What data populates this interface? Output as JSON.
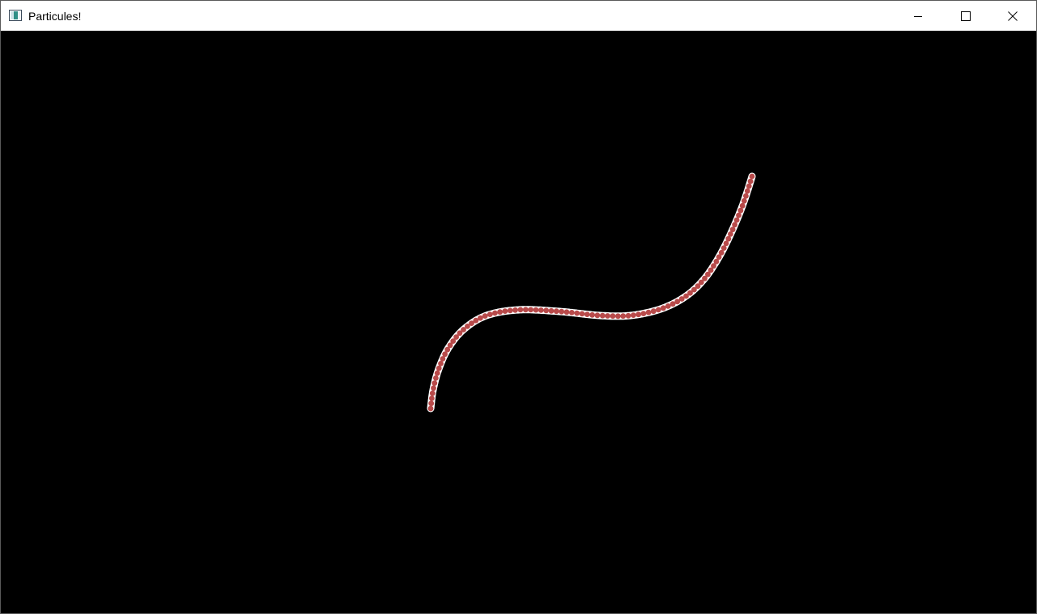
{
  "window": {
    "title": "Particules!",
    "icons": {
      "app": "app-window-icon",
      "minimize": "minimize-icon",
      "maximize": "maximize-icon",
      "close": "close-icon"
    }
  },
  "scene": {
    "background_color": "#000000",
    "particle_color": "#b84a4a",
    "particle_outline_color": "#ffffff",
    "particle_count": 90
  }
}
